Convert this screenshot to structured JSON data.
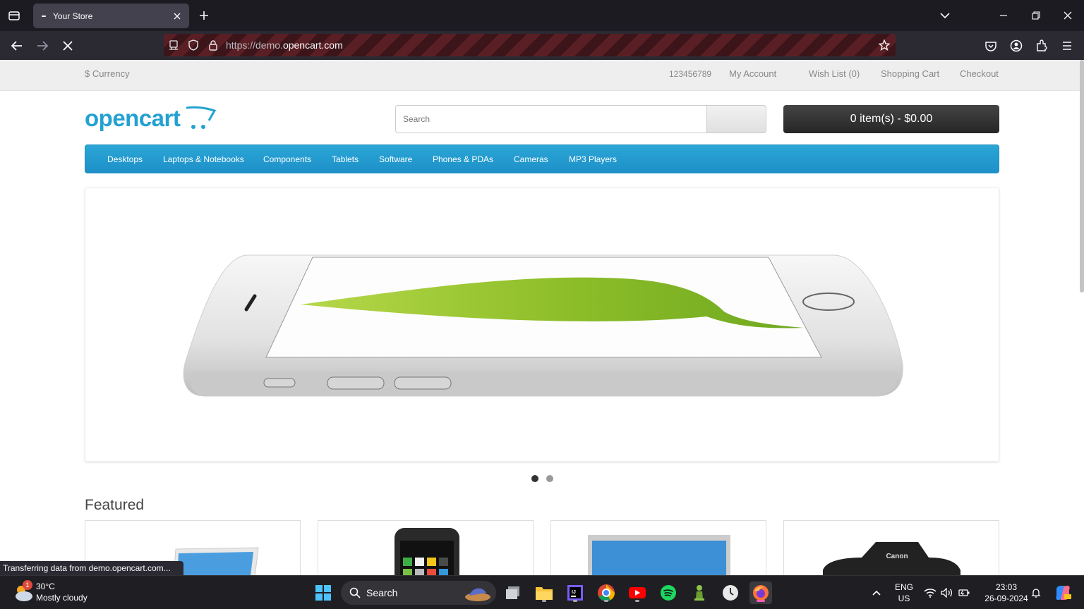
{
  "browser": {
    "tab_title": "Your Store",
    "url_prefix": "https://demo.",
    "url_host": "opencart.com"
  },
  "store": {
    "currency_label": "$ Currency",
    "phone": "123456789",
    "my_account": "My Account",
    "wish_list": "Wish List (0)",
    "shopping_cart": "Shopping Cart",
    "checkout": "Checkout",
    "logo_text": "opencart",
    "search_placeholder": "Search",
    "cart_button": "0 item(s) - $0.00",
    "menu": [
      "Desktops",
      "Laptops & Notebooks",
      "Components",
      "Tablets",
      "Software",
      "Phones & PDAs",
      "Cameras",
      "MP3 Players"
    ],
    "featured_heading": "Featured"
  },
  "status_tip": "Transferring data from demo.opencart.com...",
  "taskbar": {
    "weather_badge": "1",
    "weather_temp": "30°C",
    "weather_desc": "Mostly cloudy",
    "search_label": "Search",
    "lang_top": "ENG",
    "lang_bottom": "US",
    "time": "23:03",
    "date": "26-09-2024"
  },
  "colors": {
    "menu_blue": "#229ac8",
    "logo_blue": "#23a1d1",
    "cart_dark": "#303030"
  }
}
